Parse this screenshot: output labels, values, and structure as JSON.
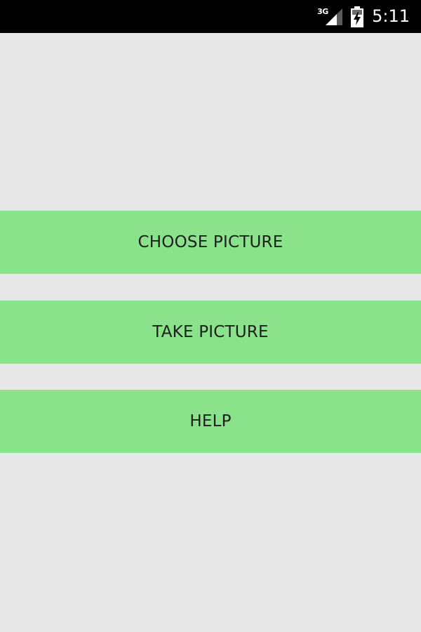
{
  "status_bar": {
    "network_label": "3G",
    "time": "5:11",
    "icons": [
      "signal-icon",
      "battery-charging-icon"
    ]
  },
  "buttons": {
    "choose_picture": "CHOOSE PICTURE",
    "take_picture": "TAKE PICTURE",
    "help": "HELP"
  },
  "colors": {
    "background": "#e8e8e8",
    "status_bar": "#000000",
    "button_background": "#8ae28a",
    "button_text": "#1e1e1e"
  }
}
